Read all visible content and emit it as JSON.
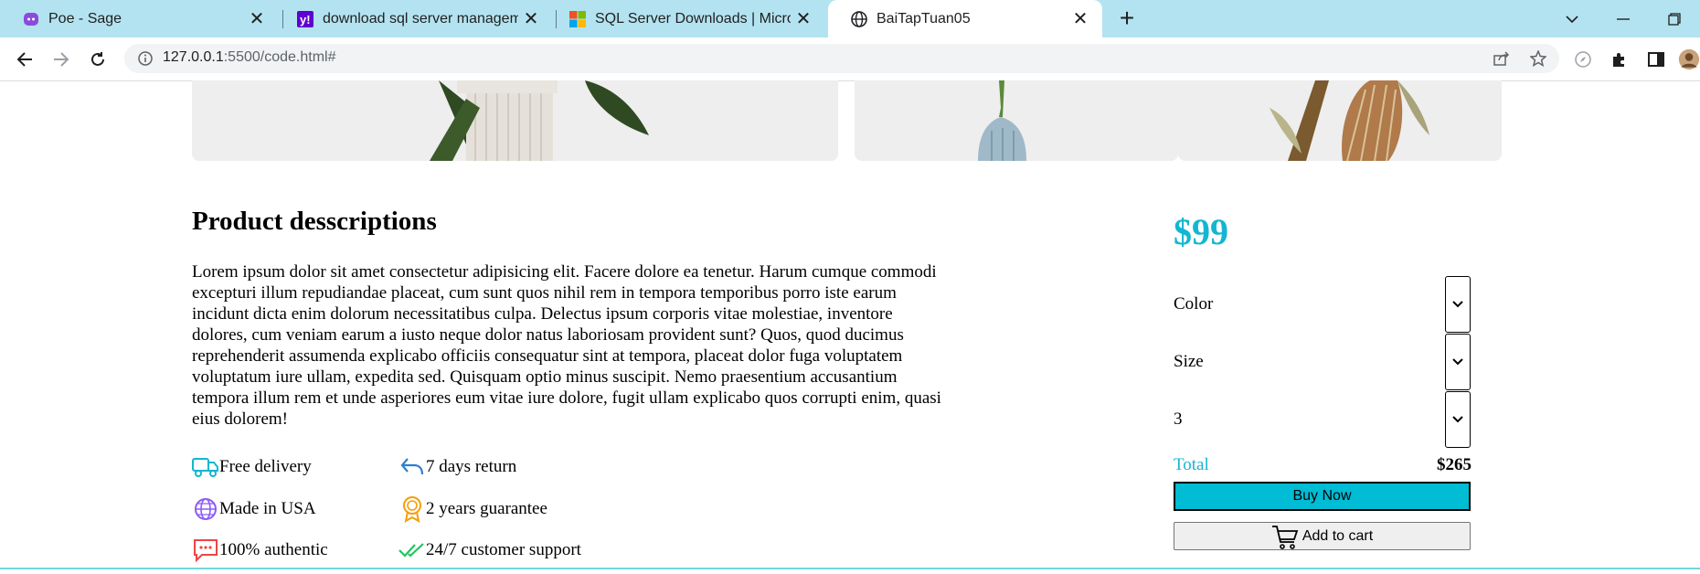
{
  "browser": {
    "tabs": [
      {
        "title": "Poe - Sage",
        "icon": "poe-icon"
      },
      {
        "title": "download sql server managemen",
        "icon": "yahoo-icon"
      },
      {
        "title": "SQL Server Downloads | Microsof",
        "icon": "microsoft-icon"
      },
      {
        "title": "BaiTapTuan05",
        "icon": "globe-icon",
        "active": true
      }
    ],
    "url_host": "127.0.0.1",
    "url_path": ":5500/code.html#"
  },
  "product": {
    "heading": "Product desscriptions",
    "description": "Lorem ipsum dolor sit amet consectetur adipisicing elit. Facere dolore ea tenetur. Harum cumque commodi excepturi illum repudiandae placeat, cum sunt quos nihil rem in tempora temporibus porro iste earum incidunt dicta enim dolorum necessitatibus culpa. Delectus ipsum corporis vitae molestiae, inventore dolores, cum veniam earum a iusto neque dolor natus laboriosam provident sunt? Quos, quod ducimus reprehenderit assumenda explicabo officiis consequatur sint at tempora, placeat dolor fuga voluptatem voluptatum iure ullam, expedita sed. Quisquam optio minus suscipit. Nemo praesentium accusantium tempora illum rem et unde asperiores eum vitae iure dolore, fugit ullam explicabo quos corrupti enim, quasi eius dolorem!",
    "features": [
      {
        "label": "Free delivery",
        "icon": "truck-icon"
      },
      {
        "label": "7 days return",
        "icon": "return-arrow-icon"
      },
      {
        "label": "Made in USA",
        "icon": "globe-icon"
      },
      {
        "label": "2 years guarantee",
        "icon": "award-icon"
      },
      {
        "label": "100% authentic",
        "icon": "chat-icon"
      },
      {
        "label": "24/7 customer support",
        "icon": "double-check-icon"
      }
    ]
  },
  "purchase": {
    "price": "$99",
    "color_label": "Color",
    "size_label": "Size",
    "quantity_value": "3",
    "total_label": "Total",
    "total_value": "$265",
    "buy_label": "Buy Now",
    "cart_label": "Add to cart"
  },
  "colors": {
    "accent": "#13b6d2",
    "buy_button": "#00bcd4",
    "tab_strip": "#b3e3f0"
  }
}
